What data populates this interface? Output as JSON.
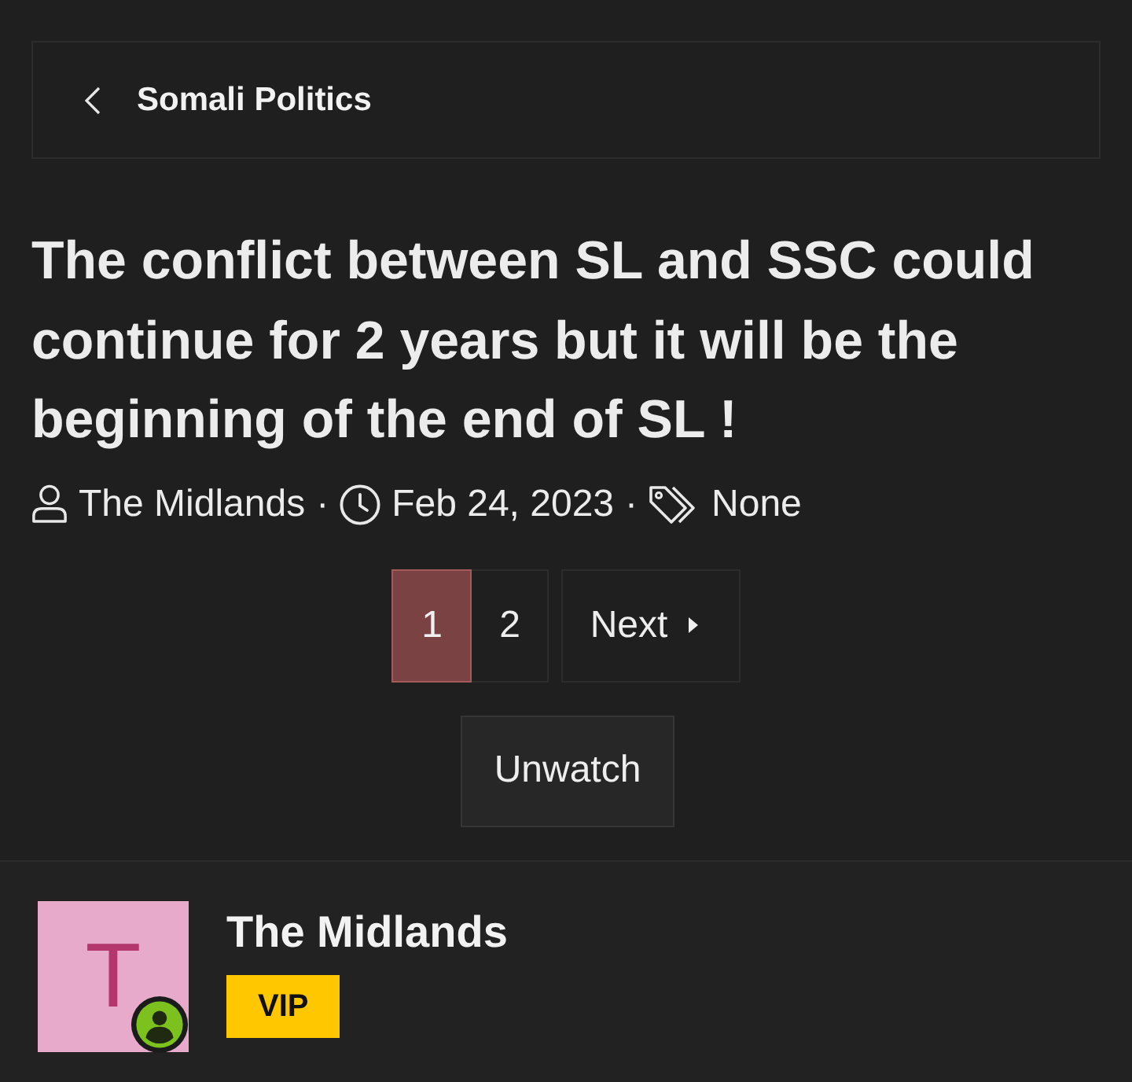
{
  "breadcrumb": {
    "label": "Somali Politics"
  },
  "thread": {
    "title": "The conflict between SL and SSC could continue for 2 years but it will be the beginning of the end of SL !",
    "meta": [
      {
        "kind": "author",
        "text": "The Midlands"
      },
      {
        "kind": "separator",
        "text": "·"
      },
      {
        "kind": "date",
        "text": "Feb 24, 2023"
      },
      {
        "kind": "separator",
        "text": "·"
      },
      {
        "kind": "tags",
        "text": "None"
      }
    ]
  },
  "pagination": {
    "pages": [
      {
        "label": "1",
        "selected": true
      },
      {
        "label": "2",
        "selected": false
      }
    ],
    "next": "Next"
  },
  "watch_button": {
    "label": "Unwatch"
  },
  "post": {
    "avatar_letter": "T",
    "online": true,
    "author": "The Midlands",
    "badge": "VIP"
  }
}
